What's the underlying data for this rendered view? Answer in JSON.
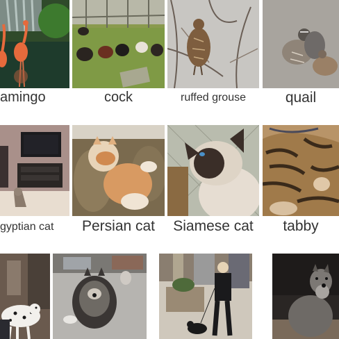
{
  "grid": {
    "row1": [
      "amingo",
      "cock",
      "ruffed grouse",
      "quail"
    ],
    "row2": [
      "gyptian cat",
      "Persian cat",
      "Siamese cat",
      "tabby"
    ]
  }
}
